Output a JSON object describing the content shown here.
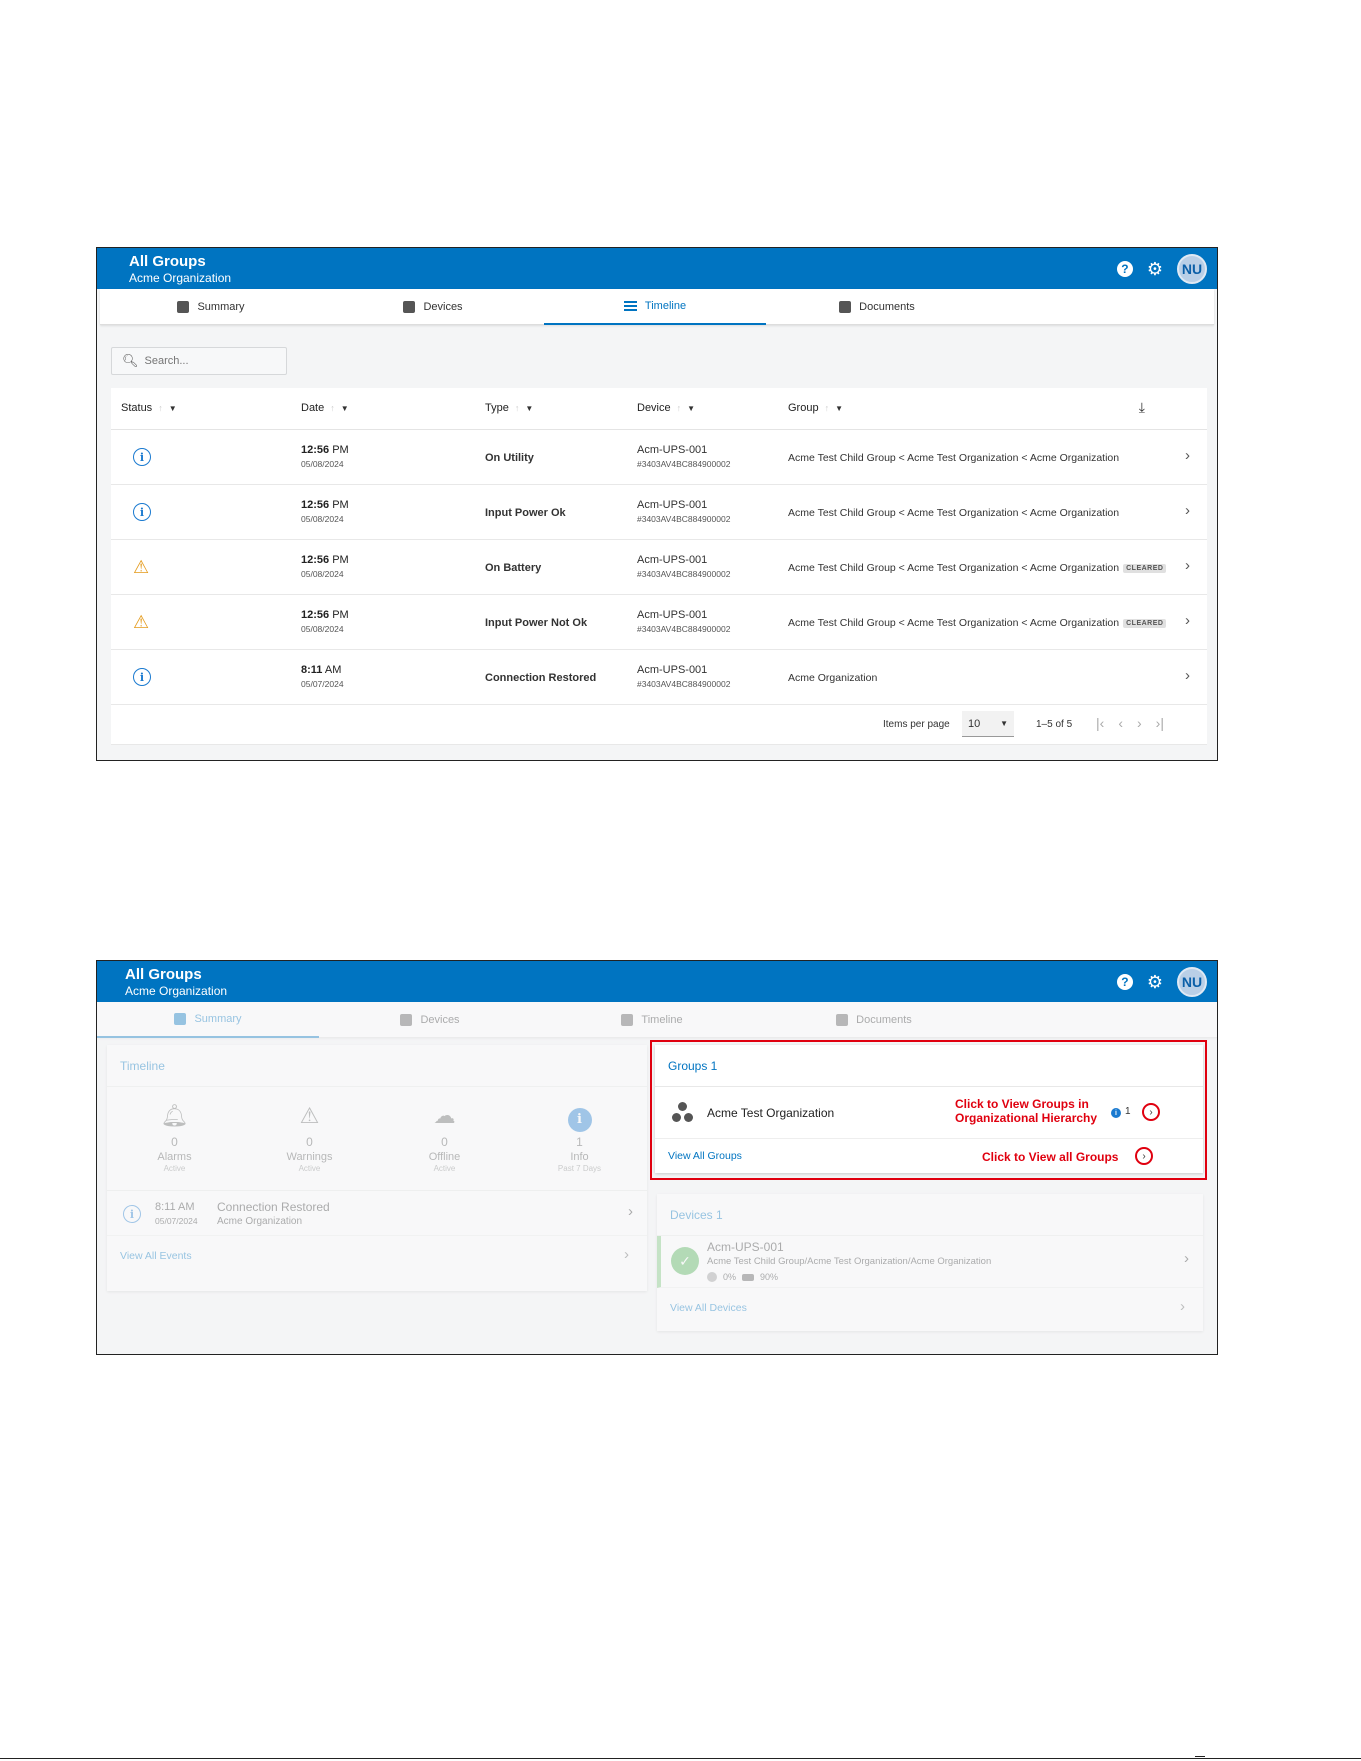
{
  "app": {
    "title": "All Groups",
    "subtitle": "Acme Organization",
    "avatar": "NU"
  },
  "tabs": [
    "Summary",
    "Devices",
    "Timeline",
    "Documents"
  ],
  "search": {
    "placeholder": "Search..."
  },
  "table": {
    "columns": [
      "Status",
      "Date",
      "Type",
      "Device",
      "Group"
    ],
    "rows": [
      {
        "status": "info",
        "time": "12:56",
        "ampm": "PM",
        "date": "05/08/2024",
        "type": "On Utility",
        "device": "Acm-UPS-001",
        "serial": "#3403AV4BC884900002",
        "group": "Acme Test Child Group < Acme Test Organization < Acme Organization",
        "badge": ""
      },
      {
        "status": "info",
        "time": "12:56",
        "ampm": "PM",
        "date": "05/08/2024",
        "type": "Input Power Ok",
        "device": "Acm-UPS-001",
        "serial": "#3403AV4BC884900002",
        "group": "Acme Test Child Group < Acme Test Organization < Acme Organization",
        "badge": ""
      },
      {
        "status": "warning",
        "time": "12:56",
        "ampm": "PM",
        "date": "05/08/2024",
        "type": "On Battery",
        "device": "Acm-UPS-001",
        "serial": "#3403AV4BC884900002",
        "group": "Acme Test Child Group < Acme Test Organization < Acme Organization",
        "badge": "CLEARED"
      },
      {
        "status": "warning",
        "time": "12:56",
        "ampm": "PM",
        "date": "05/08/2024",
        "type": "Input Power Not Ok",
        "device": "Acm-UPS-001",
        "serial": "#3403AV4BC884900002",
        "group": "Acme Test Child Group < Acme Test Organization < Acme Organization",
        "badge": "CLEARED"
      },
      {
        "status": "info",
        "time": "8:11",
        "ampm": "AM",
        "date": "05/07/2024",
        "type": "Connection Restored",
        "device": "Acm-UPS-001",
        "serial": "#3403AV4BC884900002",
        "group": "Acme Organization",
        "badge": ""
      }
    ]
  },
  "pager": {
    "items_label": "Items per page",
    "page_size": "10",
    "range": "1–5 of 5"
  },
  "summary": {
    "timeline_title": "Timeline",
    "stats": [
      {
        "count": "0",
        "label": "Alarms",
        "sub": "Active"
      },
      {
        "count": "0",
        "label": "Warnings",
        "sub": "Active"
      },
      {
        "count": "0",
        "label": "Offline",
        "sub": "Active"
      },
      {
        "count": "1",
        "label": "Info",
        "sub": "Past 7 Days"
      }
    ],
    "event": {
      "time": "8:11",
      "ampm": "AM",
      "date": "05/07/2024",
      "title": "Connection Restored",
      "group": "Acme Organization"
    },
    "view_all_events": "View All Events",
    "groups_title": "Groups 1",
    "group_name": "Acme Test Organization",
    "group_count": "1",
    "view_all_groups": "View All Groups",
    "callout_hierarchy_1": "Click to View Groups in",
    "callout_hierarchy_2": "Organizational Hierarchy",
    "callout_all": "Click to View all Groups",
    "devices_title": "Devices 1",
    "device_name": "Acm-UPS-001",
    "device_path": "Acme Test Child Group/Acme Test Organization/Acme Organization",
    "device_load": "0%",
    "device_battery": "90%",
    "view_all_devices": "View All Devices"
  },
  "colors": {
    "brand": "#0074c1",
    "annotation": "#e0000f",
    "warning": "#e49a1b"
  }
}
